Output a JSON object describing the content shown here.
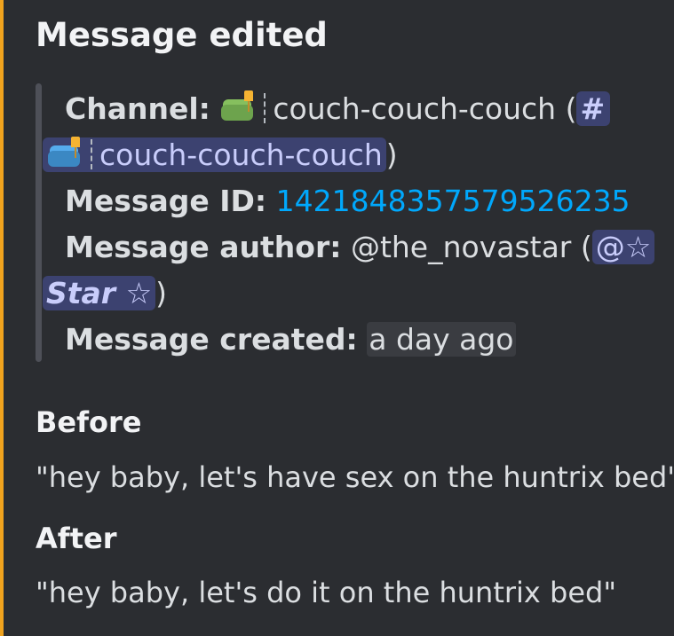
{
  "embed": {
    "title": "Message edited",
    "accent_color": "#f0a31e"
  },
  "fields": {
    "channel": {
      "label": "Channel:",
      "name": "couch-couch-couch",
      "open_paren": "(",
      "mention_hash": "#",
      "mention_name": "couch-couch-couch",
      "close_paren": ")",
      "emoji_primary": "couch-lamp-emoji-green",
      "emoji_mention": "couch-lamp-emoji-blue"
    },
    "message_id": {
      "label": "Message ID:",
      "value": "1421848357579526235"
    },
    "author": {
      "label": "Message author:",
      "username": "@the_novastar",
      "open_paren": "(",
      "mention_prefix": "@☆",
      "mention_name": "Star ☆",
      "close_paren": ")"
    },
    "created": {
      "label": "Message created:",
      "value": "a day ago"
    }
  },
  "before": {
    "title": "Before",
    "text": "\"hey baby, let's have sex on the huntrix bed\""
  },
  "after": {
    "title": "After",
    "text": "\"hey baby, let's do it on the huntrix bed\""
  },
  "colors": {
    "background": "#2b2d31",
    "link": "#00a8fc",
    "mention_bg": "#3c4270",
    "mention_text": "#c9cdfb"
  }
}
